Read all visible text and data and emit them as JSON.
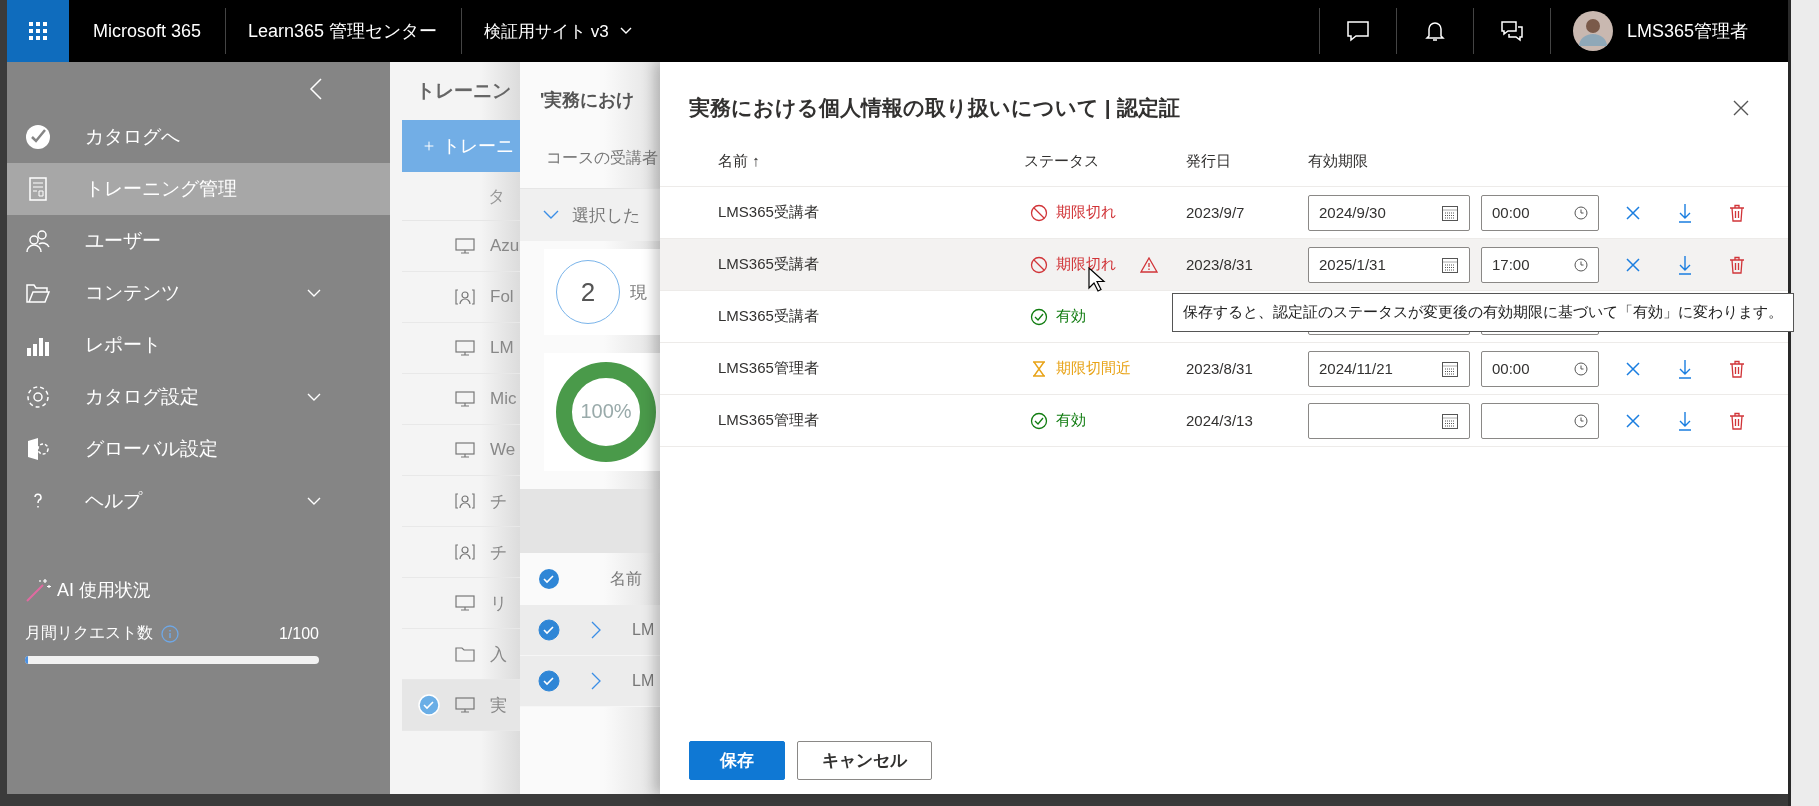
{
  "top_bar": {
    "brand": "Microsoft 365",
    "app": "Learn365 管理センター",
    "site": "検証用サイト v3",
    "user": "LMS365管理者"
  },
  "sidebar": {
    "items": [
      {
        "label": "カタログへ",
        "selected": false,
        "expandable": false
      },
      {
        "label": "トレーニング管理",
        "selected": true,
        "expandable": false
      },
      {
        "label": "ユーザー",
        "selected": false,
        "expandable": false
      },
      {
        "label": "コンテンツ",
        "selected": false,
        "expandable": true
      },
      {
        "label": "レポート",
        "selected": false,
        "expandable": false
      },
      {
        "label": "カタログ設定",
        "selected": false,
        "expandable": true
      },
      {
        "label": "グローバル設定",
        "selected": false,
        "expandable": false
      },
      {
        "label": "ヘルプ",
        "selected": false,
        "expandable": true
      }
    ],
    "ai": {
      "title": "AI 使用状況",
      "label": "月間リクエスト数",
      "count": "1/100",
      "level": 0.01
    }
  },
  "training_panel": {
    "title": "トレーニン",
    "add_button": "トレーニ",
    "column_1": "タ",
    "rows": [
      {
        "kind": "online",
        "text": "Azu",
        "selected": false
      },
      {
        "kind": "classroom",
        "text": "Fol",
        "selected": false
      },
      {
        "kind": "online",
        "text": "LM",
        "selected": false
      },
      {
        "kind": "online",
        "text": "Mic",
        "selected": false
      },
      {
        "kind": "online",
        "text": "We",
        "selected": false
      },
      {
        "kind": "classroom",
        "text": "チ",
        "selected": false
      },
      {
        "kind": "classroom",
        "text": "チ",
        "selected": false
      },
      {
        "kind": "online",
        "text": "リ",
        "selected": false
      },
      {
        "kind": "folder",
        "text": "入",
        "selected": false
      },
      {
        "kind": "online",
        "text": "実",
        "selected": true
      }
    ]
  },
  "course_panel": {
    "title": "'実務におけ",
    "subtitle": "コースの受講者",
    "group": "選択した",
    "count": "2",
    "count_label": "現",
    "percent": "100%",
    "column_1": "名前",
    "rows": [
      {
        "text": "LM",
        "checked": true
      },
      {
        "text": "LM",
        "checked": true
      }
    ]
  },
  "dialog": {
    "title": "実務における個人情報の取り扱いについて | 認定証",
    "columns": [
      "名前 ↑",
      "ステータス",
      "発行日",
      "有効期限"
    ],
    "rows": [
      {
        "name": "LMS365受講者",
        "kind": "expired",
        "status_text": "期限切れ",
        "warning": false,
        "issued": "2023/9/7",
        "expiry_date": "2024/9/30",
        "expiry_time": "00:00",
        "actions": true,
        "selected": false
      },
      {
        "name": "LMS365受講者",
        "kind": "expired",
        "status_text": "期限切れ",
        "warning": true,
        "issued": "2023/8/31",
        "expiry_date": "2025/1/31",
        "expiry_time": "17:00",
        "actions": true,
        "selected": true
      },
      {
        "name": "LMS365受講者",
        "kind": "valid",
        "status_text": "有効",
        "warning": false,
        "actions": false,
        "selected": false
      },
      {
        "name": "LMS365管理者",
        "kind": "expiring",
        "status_text": "期限切間近",
        "warning": false,
        "issued": "2023/8/31",
        "expiry_date": "2024/11/21",
        "expiry_time": "00:00",
        "actions": true,
        "selected": false
      },
      {
        "name": "LMS365管理者",
        "kind": "valid",
        "status_text": "有効",
        "warning": false,
        "issued": "2024/3/13",
        "actions": true,
        "selected": false
      }
    ],
    "tooltip": "保存すると、認定証のステータスが変更後の有効期限に基づいて「有効」に変わります。",
    "save": "保存",
    "cancel": "キャンセル"
  }
}
